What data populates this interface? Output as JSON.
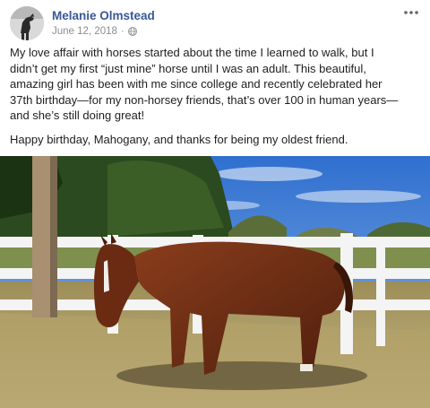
{
  "post": {
    "author": "Melanie Olmstead",
    "date": "June 12, 2018",
    "separator": "·",
    "audience_icon": "globe-icon",
    "more_icon": "more-options-icon",
    "body_lines": [
      "My love affair with horses started about the time I learned to walk, but I",
      "didn’t get my first “just mine” horse until I was an adult. This beautiful,",
      "amazing girl has been with me since college and recently celebrated her",
      "37th birthday—for my non-horsey friends, that’s over 100 in human years—",
      "and she’s still doing great!"
    ],
    "closing_line": "Happy birthday, Mahogany, and thanks for being my oldest friend.",
    "photo_subject": "chestnut horse standing in front of white fence"
  },
  "colors": {
    "author_link": "#385898",
    "meta_text": "#8a8d91",
    "body_text": "#1c1e21",
    "sky": "#4b86d6",
    "horse": "#6e2d16",
    "fence": "#f2f2f2",
    "grass": "#b9a874"
  }
}
